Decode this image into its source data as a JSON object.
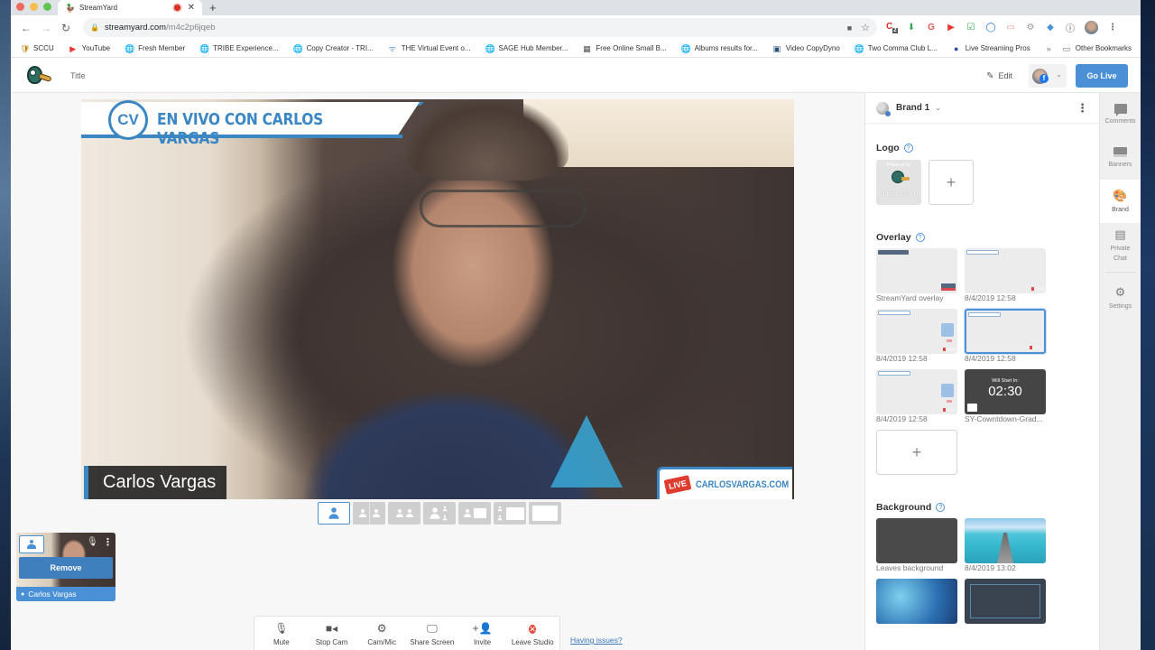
{
  "browser": {
    "tab_title": "StreamYard",
    "url_host": "streamyard.com",
    "url_path": "/m4c2p6jqeb",
    "extension_badge": "2",
    "bookmarks": [
      {
        "label": "SCCU",
        "icon": "shield-icon"
      },
      {
        "label": "YouTube",
        "icon": "youtube-icon"
      },
      {
        "label": "Fresh Member",
        "icon": "globe-icon"
      },
      {
        "label": "TRIBE Experience...",
        "icon": "globe-icon"
      },
      {
        "label": "Copy Creator - TRI...",
        "icon": "globe-icon"
      },
      {
        "label": "THE Virtual Event o...",
        "icon": "antenna-icon"
      },
      {
        "label": "SAGE Hub Member...",
        "icon": "globe-icon"
      },
      {
        "label": "Free Online Small B...",
        "icon": "calendar-icon"
      },
      {
        "label": "Albums results for...",
        "icon": "globe-icon"
      },
      {
        "label": "Video CopyDyno",
        "icon": "app-icon"
      },
      {
        "label": "Two Comma Club L...",
        "icon": "globe-icon"
      },
      {
        "label": "Live Streaming Pros",
        "icon": "lsp-icon"
      }
    ],
    "bookmarks_more": "»",
    "other_bookmarks": "Other Bookmarks"
  },
  "header": {
    "title": "Title",
    "edit_label": "Edit",
    "go_live_label": "Go Live",
    "destination_badge": "f"
  },
  "stage": {
    "banner_text": "EN VIVO CON CARLOS VARGAS",
    "banner_logo": "CV",
    "name_tag": "Carlos Vargas",
    "live_badge": "LIVE",
    "site_text": "CARLOSVARGAS.COM"
  },
  "layouts": [
    {
      "name": "solo",
      "active": true
    },
    {
      "name": "thin",
      "active": false
    },
    {
      "name": "group",
      "active": false
    },
    {
      "name": "leader",
      "active": false
    },
    {
      "name": "small-screen",
      "active": false
    },
    {
      "name": "large-screen",
      "active": false
    },
    {
      "name": "screen-only",
      "active": false
    }
  ],
  "participant": {
    "name": "Carlos Vargas",
    "remove_label": "Remove"
  },
  "controls": [
    {
      "label": "Mute",
      "icon": "microphone-icon"
    },
    {
      "label": "Stop Cam",
      "icon": "video-camera-icon"
    },
    {
      "label": "Cam/Mic",
      "icon": "gear-icon"
    },
    {
      "label": "Share Screen",
      "icon": "monitor-icon"
    },
    {
      "label": "Invite",
      "icon": "add-person-icon"
    },
    {
      "label": "Leave Studio",
      "icon": "leave-icon"
    }
  ],
  "having_issues": "Having issues?",
  "brand_panel": {
    "brand_name": "Brand 1",
    "logo_title": "Logo",
    "logo_tile_top": "Powered by",
    "logo_tile_bottom": "StreamYard",
    "overlay_title": "Overlay",
    "overlays": [
      {
        "label": "StreamYard overlay",
        "selected": false
      },
      {
        "label": "8/4/2019 12:58",
        "selected": false
      },
      {
        "label": "8/4/2019 12:58",
        "selected": false
      },
      {
        "label": "8/4/2019 12:58",
        "selected": true
      },
      {
        "label": "8/4/2019 12:58",
        "selected": false
      },
      {
        "label": "SY-Cowntdown-Grad...",
        "selected": false,
        "countdown_caption": "Will Start In:",
        "countdown_time": "02:30"
      }
    ],
    "background_title": "Background",
    "backgrounds": [
      {
        "label": "Leaves background"
      },
      {
        "label": "8/4/2019 13:02"
      },
      {
        "label": ""
      },
      {
        "label": ""
      }
    ],
    "add_symbol": "+"
  },
  "rail": [
    {
      "label": "Comments",
      "active": false
    },
    {
      "label": "Banners",
      "active": false
    },
    {
      "label": "Brand",
      "active": true
    },
    {
      "label": "Private Chat",
      "active": false
    },
    {
      "label": "Settings",
      "active": false
    }
  ],
  "colors": {
    "accent": "#4a90d6",
    "overlay_blue": "#3b87c4",
    "leave_red": "#e04b3d",
    "live_red": "#e03b2f"
  }
}
